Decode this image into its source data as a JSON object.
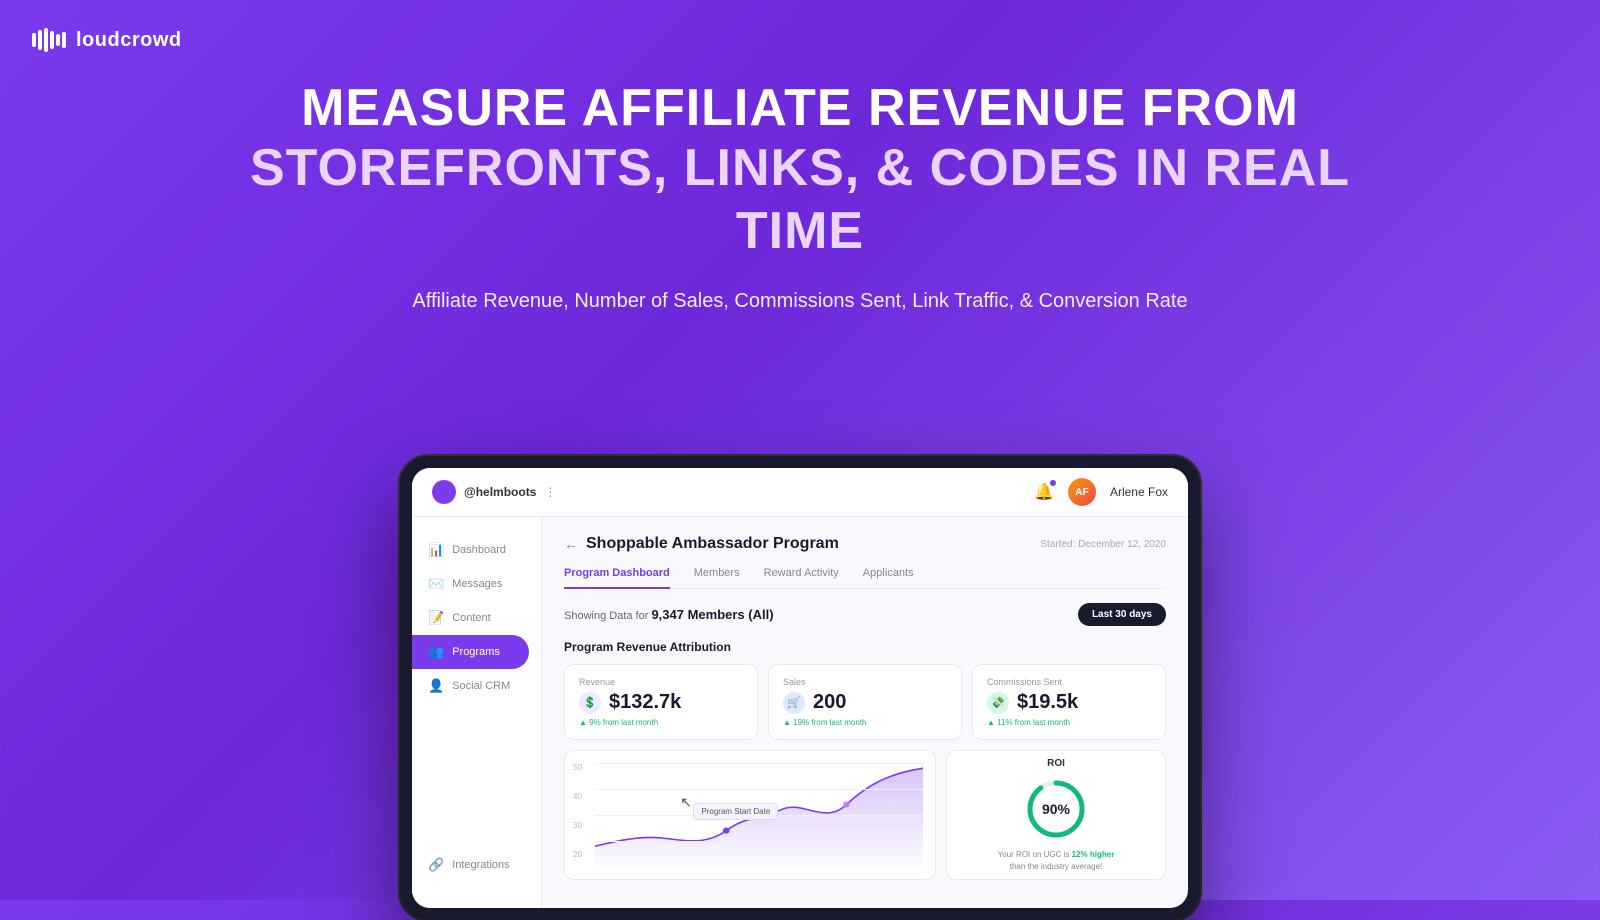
{
  "brand": {
    "name_regular": "loud",
    "name_bold": "crowd"
  },
  "headline": {
    "line1": "MEASURE AFFILIATE REVENUE FROM",
    "line2": "STOREFRONTS, LINKS, & CODES IN REAL TIME",
    "subtext": "Affiliate Revenue, Number of Sales, Commissions Sent, Link Traffic, & Conversion Rate"
  },
  "topbar": {
    "brand_handle": "@helmboots",
    "user_name": "Arlene Fox",
    "user_initials": "AF"
  },
  "sidebar": {
    "items": [
      {
        "label": "Dashboard",
        "icon": "📊",
        "active": false
      },
      {
        "label": "Messages",
        "icon": "✉️",
        "active": false
      },
      {
        "label": "Content",
        "icon": "📝",
        "active": false
      },
      {
        "label": "Programs",
        "icon": "👥",
        "active": true
      },
      {
        "label": "Social CRM",
        "icon": "👤",
        "active": false
      }
    ],
    "bottom_item": {
      "label": "Integrations",
      "icon": "🔗"
    }
  },
  "program": {
    "title": "Shoppable Ambassador Program",
    "started": "Started: December 12, 2020",
    "back_label": "←"
  },
  "tabs": [
    {
      "label": "Program Dashboard",
      "active": true
    },
    {
      "label": "Members",
      "active": false
    },
    {
      "label": "Reward Activity",
      "active": false
    },
    {
      "label": "Applicants",
      "active": false
    }
  ],
  "data_bar": {
    "showing_prefix": "Showing Data for",
    "member_count": "9,347 Members (All)",
    "button_label": "Last 30 days"
  },
  "revenue_section": {
    "title": "Program Revenue Attribution",
    "metrics": [
      {
        "label": "Revenue",
        "value": "$132.7k",
        "change": "9% from last month",
        "icon": "💲",
        "icon_style": "purple"
      },
      {
        "label": "Sales",
        "value": "200",
        "change": "19% from last month",
        "icon": "🛒",
        "icon_style": "blue"
      },
      {
        "label": "Commissions Sent",
        "value": "$19.5k",
        "change": "11% from last month",
        "icon": "💸",
        "icon_style": "teal"
      }
    ]
  },
  "chart": {
    "y_labels": [
      "50",
      "40",
      "30",
      "20"
    ],
    "tooltip_text": "Program Start Date"
  },
  "roi": {
    "label": "ROI",
    "value": "90%",
    "percentage": 90,
    "description": "Your ROI on UGC is",
    "highlight": "12% higher",
    "description2": "than the industry average!"
  }
}
